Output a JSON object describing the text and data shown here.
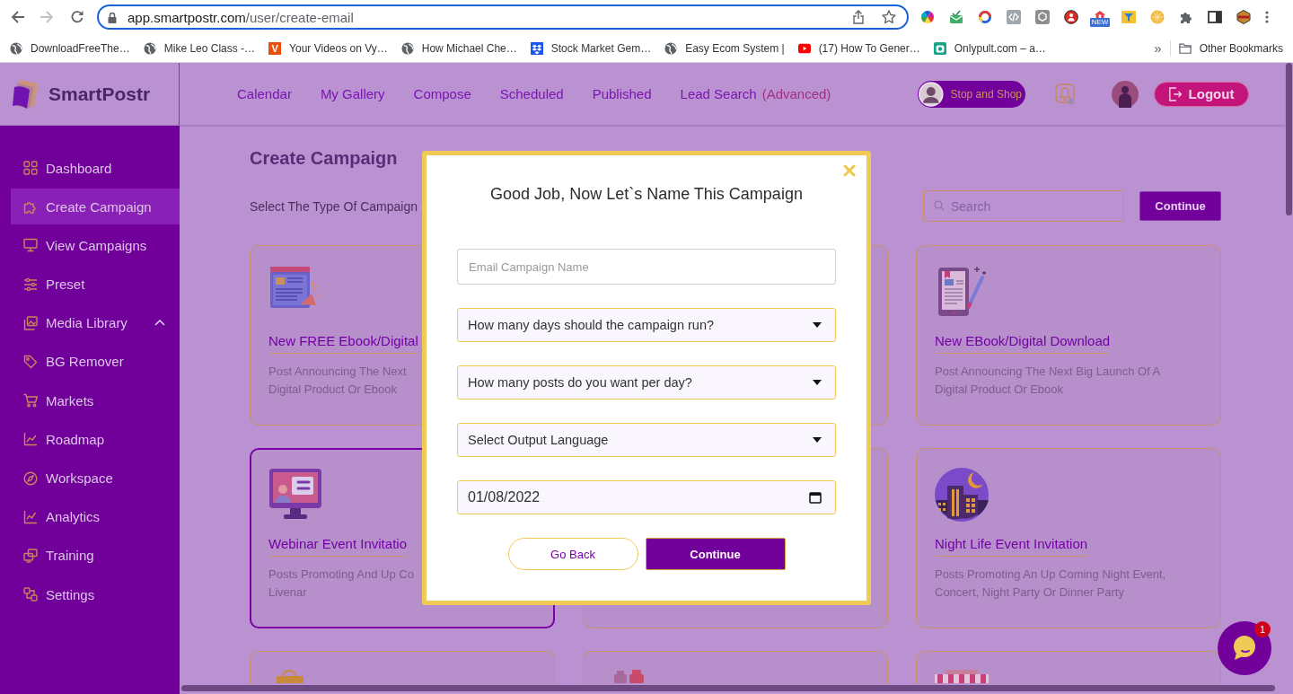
{
  "browser": {
    "url": {
      "host": "app.smartpostr.com",
      "path": "/user/create-email"
    },
    "extension_badge": "NEW",
    "bookmarks": [
      {
        "label": "DownloadFreeThe…"
      },
      {
        "label": "Mike Leo Class -…"
      },
      {
        "label": "Your Videos on Vy…",
        "icon_letter": "V"
      },
      {
        "label": "How Michael Che…"
      },
      {
        "label": "Stock Market Gem…"
      },
      {
        "label": "Easy Ecom System |"
      },
      {
        "label": "(17) How To Gener…"
      },
      {
        "label": "Onlypult.com – a…"
      }
    ],
    "overflow": "»",
    "other_bookmarks": "Other Bookmarks"
  },
  "header": {
    "logo": "SmartPostr",
    "nav": [
      {
        "label": "Calendar"
      },
      {
        "label": "My Gallery"
      },
      {
        "label": "Compose"
      },
      {
        "label": "Scheduled"
      },
      {
        "label": "Published"
      },
      {
        "label": "Lead Search",
        "note": "(Advanced)"
      }
    ],
    "workspace": "Stop and Shop",
    "logout": "Logout"
  },
  "sidebar": {
    "items": [
      {
        "label": "Dashboard",
        "kind": "link",
        "selected": false
      },
      {
        "label": "Create Campaign",
        "kind": "link",
        "selected": true
      },
      {
        "label": "View Campaigns",
        "kind": "link",
        "selected": false
      },
      {
        "label": "Preset",
        "kind": "link",
        "selected": false
      },
      {
        "label": "Media Library",
        "kind": "group",
        "selected": false
      },
      {
        "label": "BG Remover",
        "kind": "link",
        "selected": false
      },
      {
        "label": "Markets",
        "kind": "link",
        "selected": false
      },
      {
        "label": "Roadmap",
        "kind": "link",
        "selected": false
      },
      {
        "label": "Workspace",
        "kind": "link",
        "selected": false
      },
      {
        "label": "Analytics",
        "kind": "link",
        "selected": false
      },
      {
        "label": "Training",
        "kind": "link",
        "selected": false
      },
      {
        "label": "Settings",
        "kind": "link",
        "selected": false
      }
    ]
  },
  "page": {
    "title": "Create Campaign",
    "subtitle": "Select The Type Of Campaign",
    "search": {
      "placeholder": "Search"
    },
    "continue": "Continue",
    "cards": [
      {
        "title": "New FREE Ebook/Digital",
        "description": [
          "Post Announcing The Next",
          "Digital Product Or Ebook"
        ],
        "selected": false
      },
      {
        "selected": false
      },
      {
        "title": "New EBook/Digital Download",
        "description": [
          "Post Announcing The Next Big Launch Of A",
          "Digital Product Or Ebook"
        ],
        "selected": false
      },
      {
        "title": "Webinar Event Invitatio",
        "description": [
          "Posts Promoting And Up Co",
          "Livenar"
        ],
        "selected": true
      },
      {
        "selected": false
      },
      {
        "title": "Night Life Event Invitation",
        "description": [
          "Posts Promoting An Up Coming Night Event,",
          "Concert, Night Party Or Dinner Party"
        ],
        "selected": false
      },
      {
        "selected": false
      },
      {
        "selected": false
      },
      {
        "selected": false
      }
    ]
  },
  "modal": {
    "title": "Good Job, Now Let`s Name This Campaign",
    "fields": [
      {
        "kind": "text",
        "placeholder": "Email Campaign Name"
      },
      {
        "kind": "select",
        "value": "How many days should the campaign run?"
      },
      {
        "kind": "select",
        "value": "How many posts do you want per day?"
      },
      {
        "kind": "select",
        "value": "Select Output Language"
      },
      {
        "kind": "date",
        "value": "01/08/2022"
      }
    ],
    "buttons": [
      {
        "label": "Go Back",
        "kind": "secondary"
      },
      {
        "label": "Continue",
        "kind": "primary"
      }
    ]
  },
  "chat": {
    "badge": "1"
  }
}
